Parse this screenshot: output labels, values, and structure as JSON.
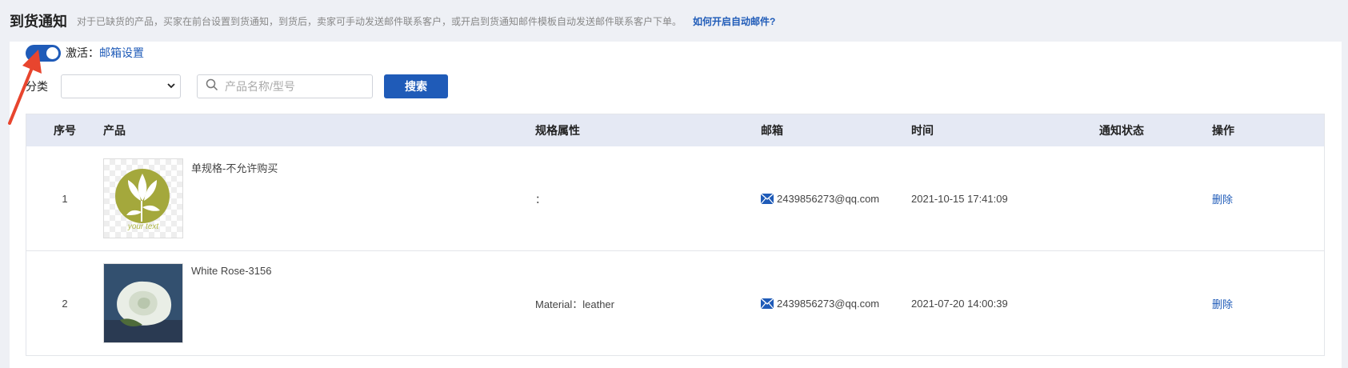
{
  "header": {
    "title": "到货通知",
    "description": "对于已缺货的产品，买家在前台设置到货通知，到货后，卖家可手动发送邮件联系客户，或开启到货通知邮件模板自动发送邮件联系客户下单。",
    "help_link": "如何开启自动邮件?"
  },
  "activation": {
    "label": "激活：",
    "enabled": true,
    "mail_settings_link": "邮箱设置"
  },
  "filter": {
    "category_label": "分类",
    "category_value": "",
    "search_placeholder": "产品名称/型号",
    "search_value": "",
    "search_button": "搜索"
  },
  "table": {
    "columns": [
      "序号",
      "产品",
      "规格属性",
      "邮箱",
      "时间",
      "通知状态",
      "操作"
    ],
    "rows": [
      {
        "no": "1",
        "product": "单规格-不允许购买",
        "thumb_text": "your text",
        "spec": "：",
        "email": "2439856273@qq.com",
        "time": "2021-10-15 17:41:09",
        "status": "",
        "action": "删除"
      },
      {
        "no": "2",
        "product": "White Rose-3156",
        "thumb_text": "",
        "spec": "Material：leather",
        "email": "2439856273@qq.com",
        "time": "2021-07-20 14:00:39",
        "status": "",
        "action": "删除"
      }
    ]
  },
  "colors": {
    "accent": "#1f5bb8",
    "header_bg": "#e5e9f4",
    "page_bg": "#eef0f5",
    "arrow": "#e8452e"
  },
  "icons": [
    "search-icon",
    "mail-icon",
    "chevron-down-icon",
    "annotation-arrow-icon"
  ]
}
